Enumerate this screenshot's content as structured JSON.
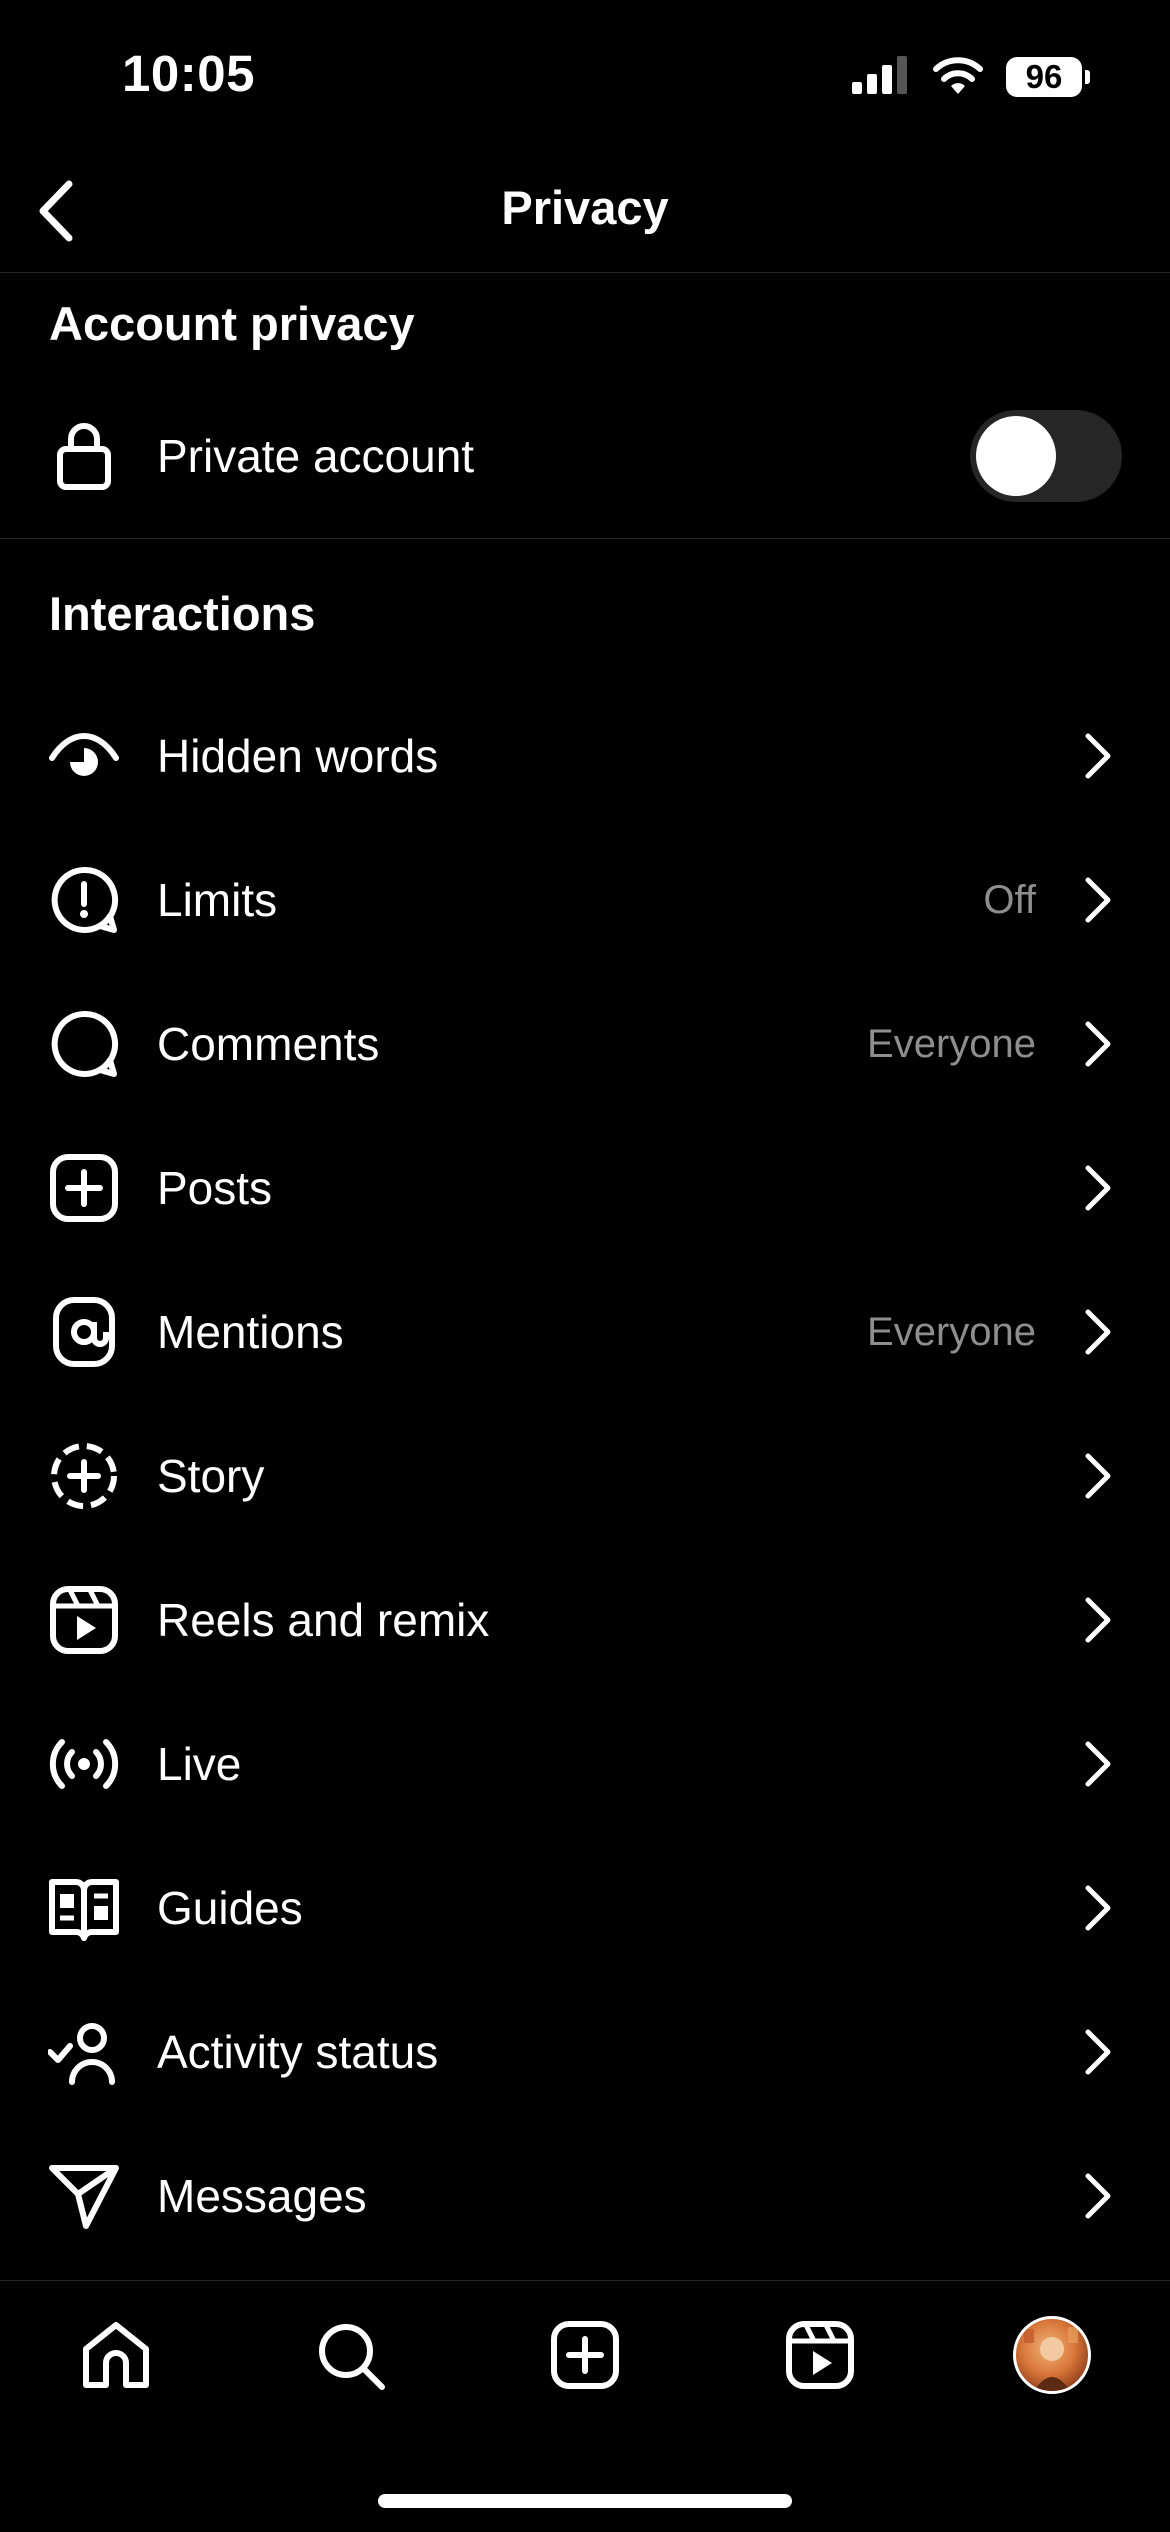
{
  "status_bar": {
    "time": "10:05",
    "battery": "96"
  },
  "header": {
    "title": "Privacy"
  },
  "account_privacy": {
    "title": "Account privacy",
    "private_account_label": "Private account",
    "private_account_enabled": false
  },
  "interactions": {
    "title": "Interactions",
    "items": [
      {
        "label": "Hidden words",
        "value": "",
        "icon": "eye-icon"
      },
      {
        "label": "Limits",
        "value": "Off",
        "icon": "limits-icon"
      },
      {
        "label": "Comments",
        "value": "Everyone",
        "icon": "comment-icon"
      },
      {
        "label": "Posts",
        "value": "",
        "icon": "post-plus-icon"
      },
      {
        "label": "Mentions",
        "value": "Everyone",
        "icon": "at-sign-icon"
      },
      {
        "label": "Story",
        "value": "",
        "icon": "story-plus-icon"
      },
      {
        "label": "Reels and remix",
        "value": "",
        "icon": "reels-icon"
      },
      {
        "label": "Live",
        "value": "",
        "icon": "live-icon"
      },
      {
        "label": "Guides",
        "value": "",
        "icon": "guides-icon"
      },
      {
        "label": "Activity status",
        "value": "",
        "icon": "activity-status-icon"
      },
      {
        "label": "Messages",
        "value": "",
        "icon": "paper-plane-icon"
      }
    ]
  },
  "tab_bar": {
    "tabs": [
      "home-icon",
      "search-icon",
      "create-icon",
      "reels-tab-icon",
      "profile-avatar"
    ]
  },
  "colors": {
    "background": "#000000",
    "text": "#ffffff",
    "secondary_text": "#8e8e8e",
    "divider": "#262626"
  }
}
